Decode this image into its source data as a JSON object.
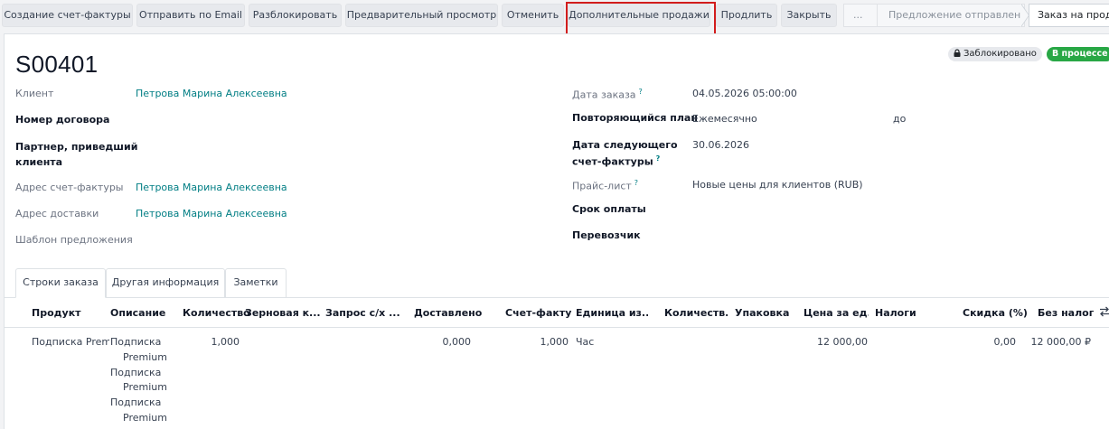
{
  "toolbar": {
    "create_invoice": "Создание счет-фактуры",
    "send_email": "Отправить по Email",
    "unlock": "Разблокировать",
    "preview": "Предварительный просмотр",
    "cancel": "Отменить",
    "upsell": "Дополнительные продажи",
    "renew": "Продлить",
    "close": "Закрыть",
    "more": "..."
  },
  "statusbar": {
    "stages": [
      "Предложение отправлено",
      "Заказ на прода"
    ]
  },
  "record": {
    "name": "S00401",
    "locked_badge": "Заблокировано",
    "state_badge": "В процессе"
  },
  "left_fields": {
    "customer_label": "Клиент",
    "customer_value": "Петрова Марина Алексеевна",
    "contract_label": "Номер договора",
    "referrer_label_line1": "Партнер, приведший",
    "referrer_label_line2": "клиента",
    "invoice_address_label": "Адрес счет-фактуры",
    "invoice_address_value": "Петрова Марина Алексеевна",
    "delivery_address_label": "Адрес доставки",
    "delivery_address_value": "Петрова Марина Алексеевна",
    "quote_template_label": "Шаблон предложения"
  },
  "right_fields": {
    "order_date_label": "Дата заказа",
    "order_date_value": "04.05.2026 05:00:00",
    "recurring_plan_label": "Повторяющийся план",
    "recurring_plan_value": "Ежемесячно",
    "recurring_until": "до",
    "next_invoice_label_line1": "Дата следующего",
    "next_invoice_label_line2": "счет-фактуры",
    "next_invoice_value": "30.06.2026",
    "pricelist_label": "Прайс-лист",
    "pricelist_value": "Новые цены для клиентов (RUB)",
    "payment_terms_label": "Срок оплаты",
    "carrier_label": "Перевозчик",
    "tooltip_mark": "?"
  },
  "tabs": [
    "Строки заказа",
    "Другая информация",
    "Заметки"
  ],
  "table": {
    "headers": [
      "Продукт",
      "Описание",
      "Количество",
      "Зерновая к...",
      "Запрос с/х ...",
      "Доставлено",
      "Счет-факту...",
      "Единица из...",
      "Количеств...",
      "Упаковка",
      "Цена за ед...",
      "Налоги",
      "Скидка (%)",
      "Без налога."
    ],
    "row": {
      "product": "Подписка Premium",
      "description": [
        "Подписка",
        "Premium",
        "Подписка",
        "Premium",
        "Подписка",
        "Premium"
      ],
      "quantity": "1,000",
      "delivered": "0,000",
      "invoiced": "1,000",
      "uom": "Час",
      "unit_price": "12 000,00",
      "discount": "0,00",
      "subtotal": "12 000,00 ₽"
    }
  },
  "icons": {
    "lock": "lock-icon",
    "optional_columns": "optional-columns-icon"
  }
}
